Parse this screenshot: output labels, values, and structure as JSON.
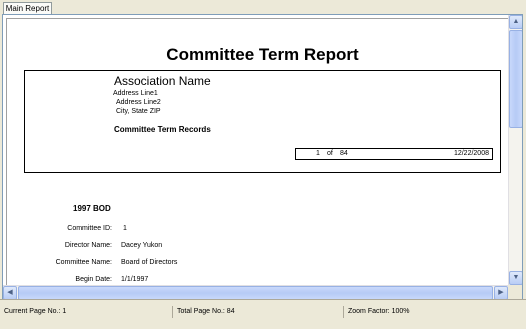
{
  "tab": {
    "label": "Main Report"
  },
  "report": {
    "title": "Committee Term Report",
    "header": {
      "association_name": "Association Name",
      "address_line1": "Address Line1",
      "address_line2": "Address Line2",
      "city_state_zip": "City, State ZIP",
      "section_title": "Committee Term Records",
      "page_current": "1",
      "page_of": "of",
      "page_total": "84",
      "date": "12/22/2008"
    },
    "record": {
      "title": "1997 BOD",
      "fields": [
        {
          "label": "Committee ID:",
          "value": "1"
        },
        {
          "label": "Director Name:",
          "value": "Dacey Yukon"
        },
        {
          "label": "Committee Name:",
          "value": "Board of Directors"
        },
        {
          "label": "Begin Date:",
          "value": "1/1/1997"
        }
      ]
    }
  },
  "scrollbars": {
    "up_arrow": "▲",
    "down_arrow": "▼",
    "left_arrow": "◀",
    "right_arrow": "▶"
  },
  "status": {
    "current_page": "Current Page No.: 1",
    "total_page": "Total Page No.: 84",
    "zoom": "Zoom Factor: 100%"
  }
}
